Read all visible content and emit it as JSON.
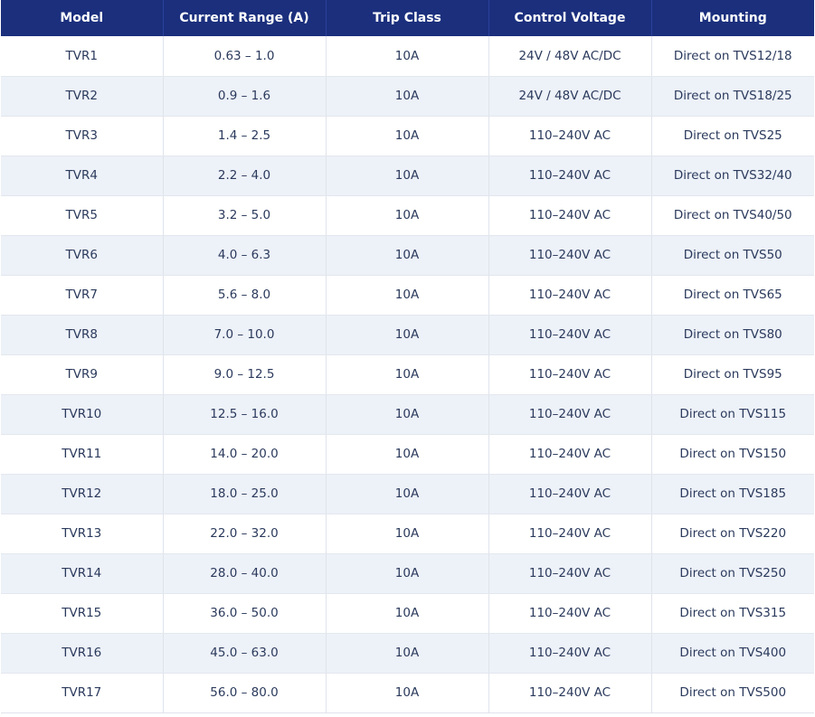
{
  "table": {
    "headers": [
      "Model",
      "Current Range (A)",
      "Trip Class",
      "Control Voltage",
      "Mounting"
    ],
    "rows": [
      [
        "TVR1",
        "0.63 – 1.0",
        "10A",
        "24V / 48V AC/DC",
        "Direct on TVS12/18"
      ],
      [
        "TVR2",
        "0.9 – 1.6",
        "10A",
        "24V / 48V AC/DC",
        "Direct on TVS18/25"
      ],
      [
        "TVR3",
        "1.4 – 2.5",
        "10A",
        "110–240V AC",
        "Direct on TVS25"
      ],
      [
        "TVR4",
        "2.2 – 4.0",
        "10A",
        "110–240V AC",
        "Direct on TVS32/40"
      ],
      [
        "TVR5",
        "3.2 – 5.0",
        "10A",
        "110–240V AC",
        "Direct on TVS40/50"
      ],
      [
        "TVR6",
        "4.0 – 6.3",
        "10A",
        "110–240V AC",
        "Direct on TVS50"
      ],
      [
        "TVR7",
        "5.6 – 8.0",
        "10A",
        "110–240V AC",
        "Direct on TVS65"
      ],
      [
        "TVR8",
        "7.0 – 10.0",
        "10A",
        "110–240V AC",
        "Direct on TVS80"
      ],
      [
        "TVR9",
        "9.0 – 12.5",
        "10A",
        "110–240V AC",
        "Direct on TVS95"
      ],
      [
        "TVR10",
        "12.5 – 16.0",
        "10A",
        "110–240V AC",
        "Direct on TVS115"
      ],
      [
        "TVR11",
        "14.0 – 20.0",
        "10A",
        "110–240V AC",
        "Direct on TVS150"
      ],
      [
        "TVR12",
        "18.0 – 25.0",
        "10A",
        "110–240V AC",
        "Direct on TVS185"
      ],
      [
        "TVR13",
        "22.0 – 32.0",
        "10A",
        "110–240V AC",
        "Direct on TVS220"
      ],
      [
        "TVR14",
        "28.0 – 40.0",
        "10A",
        "110–240V AC",
        "Direct on TVS250"
      ],
      [
        "TVR15",
        "36.0 – 50.0",
        "10A",
        "110–240V AC",
        "Direct on TVS315"
      ],
      [
        "TVR16",
        "45.0 – 63.0",
        "10A",
        "110–240V AC",
        "Direct on TVS400"
      ],
      [
        "TVR17",
        "56.0 – 80.0",
        "10A",
        "110–240V AC",
        "Direct on TVS500"
      ]
    ]
  },
  "colors": {
    "header_bg": "#1b2f7d",
    "header_text": "#ffffff",
    "row_alt_bg": "#edf1f8",
    "cell_text": "#2b3a5c"
  }
}
